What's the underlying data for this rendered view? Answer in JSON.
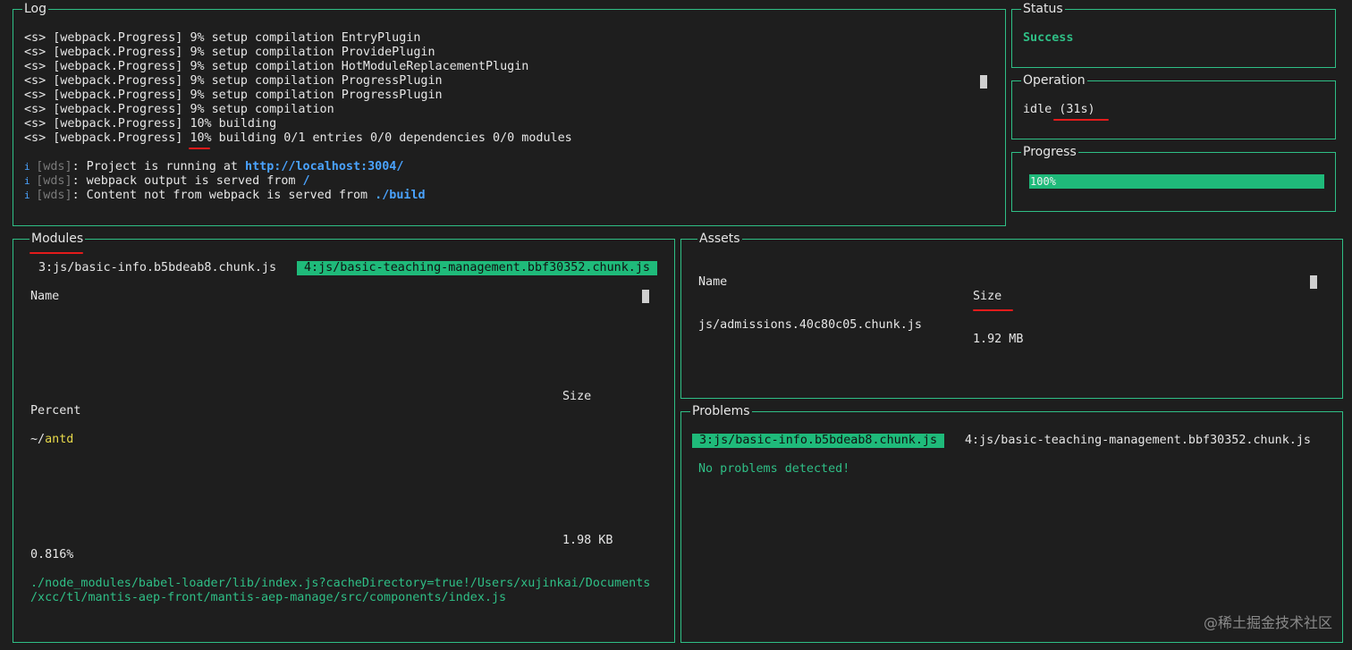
{
  "log": {
    "title": "Log",
    "lines": [
      {
        "prefix": "<s> [webpack.Progress] ",
        "pct": "9%",
        "rest": " setup compilation EntryPlugin"
      },
      {
        "prefix": "<s> [webpack.Progress] ",
        "pct": "9%",
        "rest": " setup compilation ProvidePlugin"
      },
      {
        "prefix": "<s> [webpack.Progress] ",
        "pct": "9%",
        "rest": " setup compilation HotModuleReplacementPlugin"
      },
      {
        "prefix": "<s> [webpack.Progress] ",
        "pct": "9%",
        "rest": " setup compilation ProgressPlugin"
      },
      {
        "prefix": "<s> [webpack.Progress] ",
        "pct": "9%",
        "rest": " setup compilation ProgressPlugin"
      },
      {
        "prefix": "<s> [webpack.Progress] ",
        "pct": "9%",
        "rest": " setup compilation"
      },
      {
        "prefix": "<s> [webpack.Progress] ",
        "pct": "10%",
        "rest": " building"
      },
      {
        "prefix": "<s> [webpack.Progress] ",
        "pct": "10%",
        "rest": " building 0/1 entries 0/0 dependencies 0/0 modules"
      }
    ],
    "wds": [
      {
        "icon": "i",
        "tag": "[wds]",
        "text": ": Project is running at ",
        "link": "http://localhost:3004/"
      },
      {
        "icon": "i",
        "tag": "[wds]",
        "text": ": webpack output is served from ",
        "link": "/"
      },
      {
        "icon": "i",
        "tag": "[wds]",
        "text": ": Content not from webpack is served from ",
        "link": "./build"
      }
    ]
  },
  "status": {
    "title": "Status",
    "value": "Success"
  },
  "operation": {
    "title": "Operation",
    "value": "idle (31s)"
  },
  "progress": {
    "title": "Progress",
    "value": "100%",
    "fraction": 1.0
  },
  "modules": {
    "title": "Modules",
    "tab1": "3:js/basic-info.b5bdeab8.chunk.js",
    "tab2": "4:js/basic-teaching-management.bbf30352.chunk.js",
    "col_name": "Name",
    "col_size": "Size",
    "col_percent": "Percent",
    "row_prefix": "~/",
    "row_name": "antd",
    "row_size": "1.98 KB",
    "row_percent": "0.816%",
    "path1": "./node_modules/babel-loader/lib/index.js?cacheDirectory=true!/Users/xujinkai/Documents",
    "path2": "/xcc/tl/mantis-aep-front/mantis-aep-manage/src/components/index.js"
  },
  "assets": {
    "title": "Assets",
    "col_name": "Name",
    "col_size": "Size",
    "row_name": "js/admissions.40c80c05.chunk.js",
    "row_size": "1.92 MB"
  },
  "problems": {
    "title": "Problems",
    "tab1": "3:js/basic-info.b5bdeab8.chunk.js",
    "tab2": "4:js/basic-teaching-management.bbf30352.chunk.js",
    "message": "No problems detected!"
  },
  "watermark": "@稀土掘金技术社区"
}
